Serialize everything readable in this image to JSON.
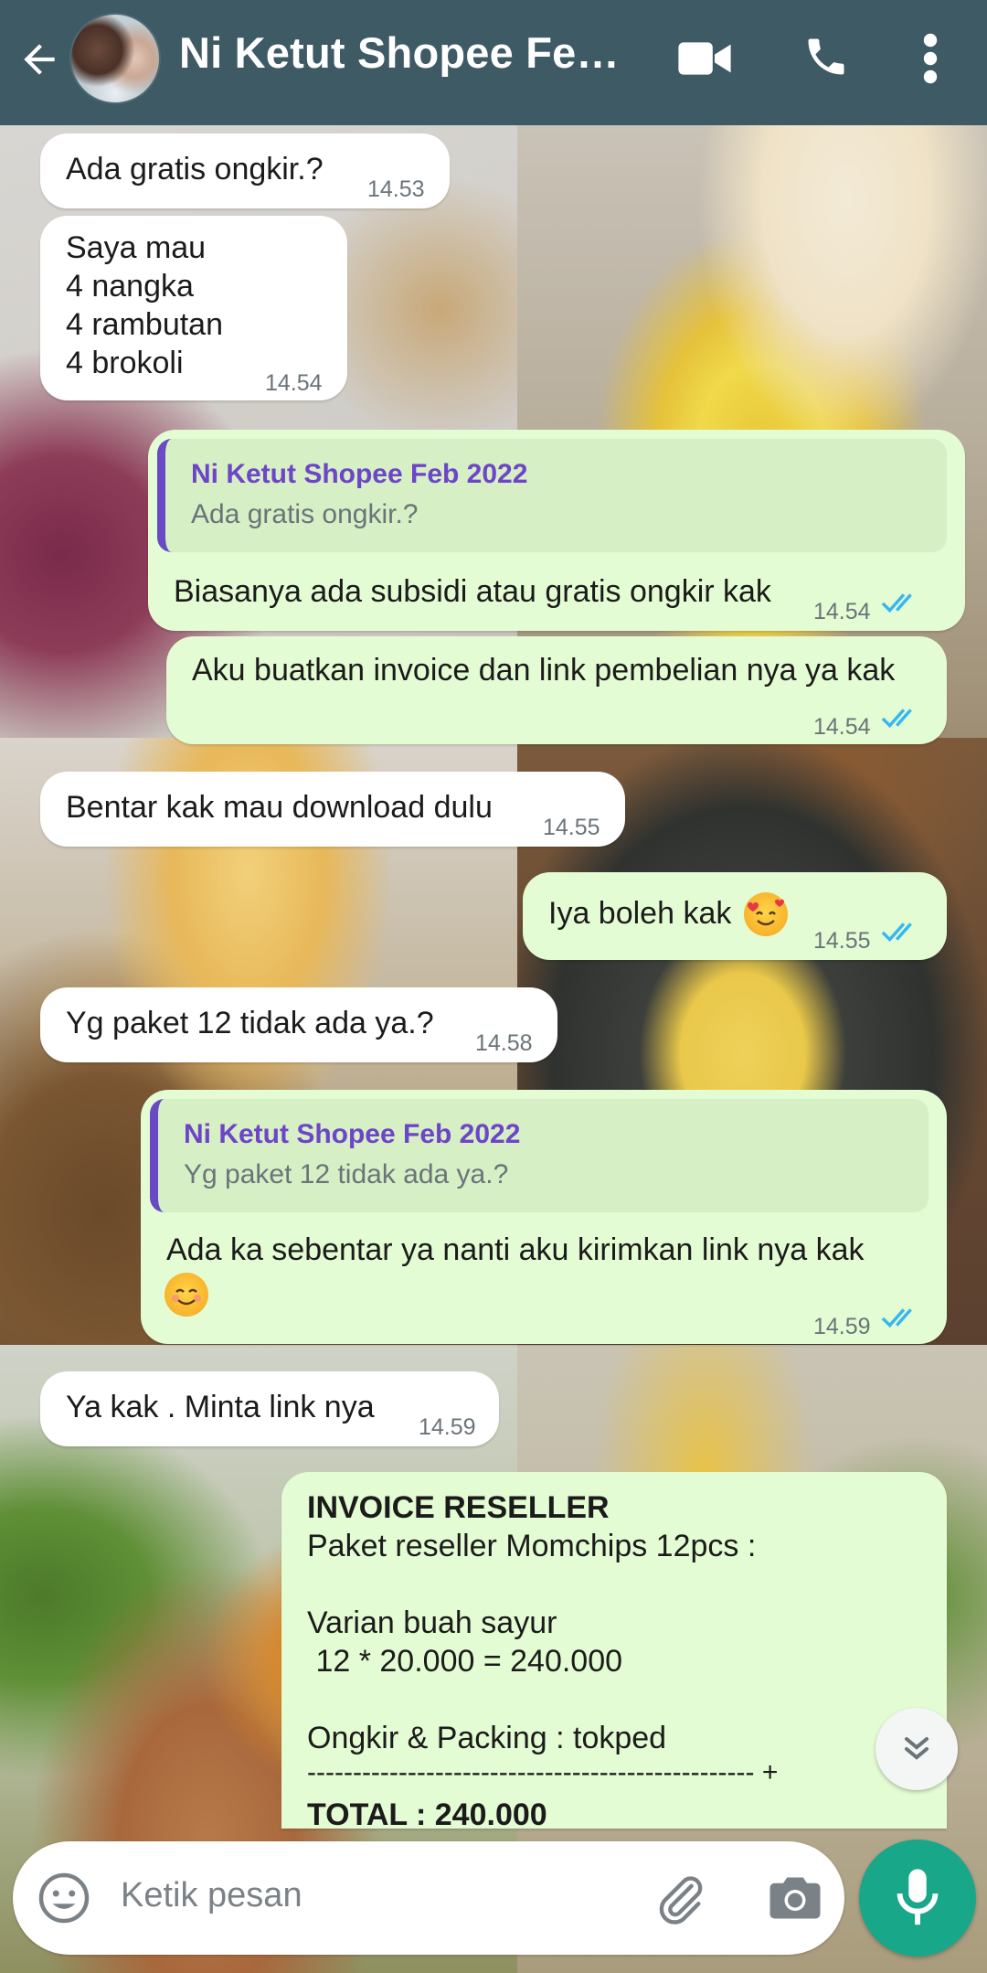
{
  "header": {
    "title": "Ni Ketut Shopee Feb...",
    "back_icon": "back-arrow-icon",
    "video_icon": "video-call-icon",
    "call_icon": "voice-call-icon",
    "menu_icon": "more-vert-icon",
    "bg_color": "#3e5a64"
  },
  "messages": {
    "m1": {
      "direction": "incoming",
      "text": "Ada gratis ongkir.?",
      "time": "14.53"
    },
    "m2": {
      "direction": "incoming",
      "lines": [
        "Saya mau",
        "4 nangka",
        "4 rambutan",
        "4 brokoli"
      ],
      "time": "14.54"
    },
    "m3": {
      "direction": "outgoing",
      "quote_name": "Ni Ketut Shopee Feb 2022",
      "quote_text": "Ada gratis ongkir.?",
      "text": "Biasanya ada subsidi atau gratis ongkir kak",
      "time": "14.54",
      "status": "read"
    },
    "m4": {
      "direction": "outgoing",
      "text": "Aku buatkan invoice dan link pembelian nya ya kak",
      "time": "14.54",
      "status": "read"
    },
    "m5": {
      "direction": "incoming",
      "text": "Bentar kak mau download dulu",
      "time": "14.55"
    },
    "m6": {
      "direction": "outgoing",
      "text": "Iya boleh kak",
      "emoji": "smiling-face-with-hearts",
      "time": "14.55",
      "status": "read"
    },
    "m7": {
      "direction": "incoming",
      "text": "Yg paket 12 tidak ada ya.?",
      "time": "14.58"
    },
    "m8": {
      "direction": "outgoing",
      "quote_name": "Ni Ketut Shopee Feb 2022",
      "quote_text": "Yg paket 12 tidak ada ya.?",
      "text": "Ada ka sebentar ya nanti aku kirimkan link nya kak",
      "emoji": "smiling-face",
      "time": "14.59",
      "status": "read"
    },
    "m9": {
      "direction": "incoming",
      "text": "Ya kak . Minta link nya",
      "time": "14.59"
    },
    "m10": {
      "direction": "outgoing",
      "title": "INVOICE RESELLER",
      "lines": [
        "Paket reseller Momchips 12pcs :",
        "",
        "Varian buah sayur",
        " 12 * 20.000 = 240.000",
        "",
        "Ongkir & Packing : tokped",
        "------------------------------------------------- +"
      ],
      "total": "TOTAL : 240.000"
    }
  },
  "composer": {
    "placeholder": "Ketik pesan",
    "emoji_icon": "emoji-icon",
    "attach_icon": "paperclip-icon",
    "camera_icon": "camera-icon",
    "mic_icon": "microphone-icon"
  },
  "colors": {
    "incoming_bubble": "#ffffff",
    "outgoing_bubble": "#e4fcd3",
    "quote_accent": "#6a49c4",
    "read_ticks": "#34b7f1",
    "mic_button": "#19a789"
  }
}
